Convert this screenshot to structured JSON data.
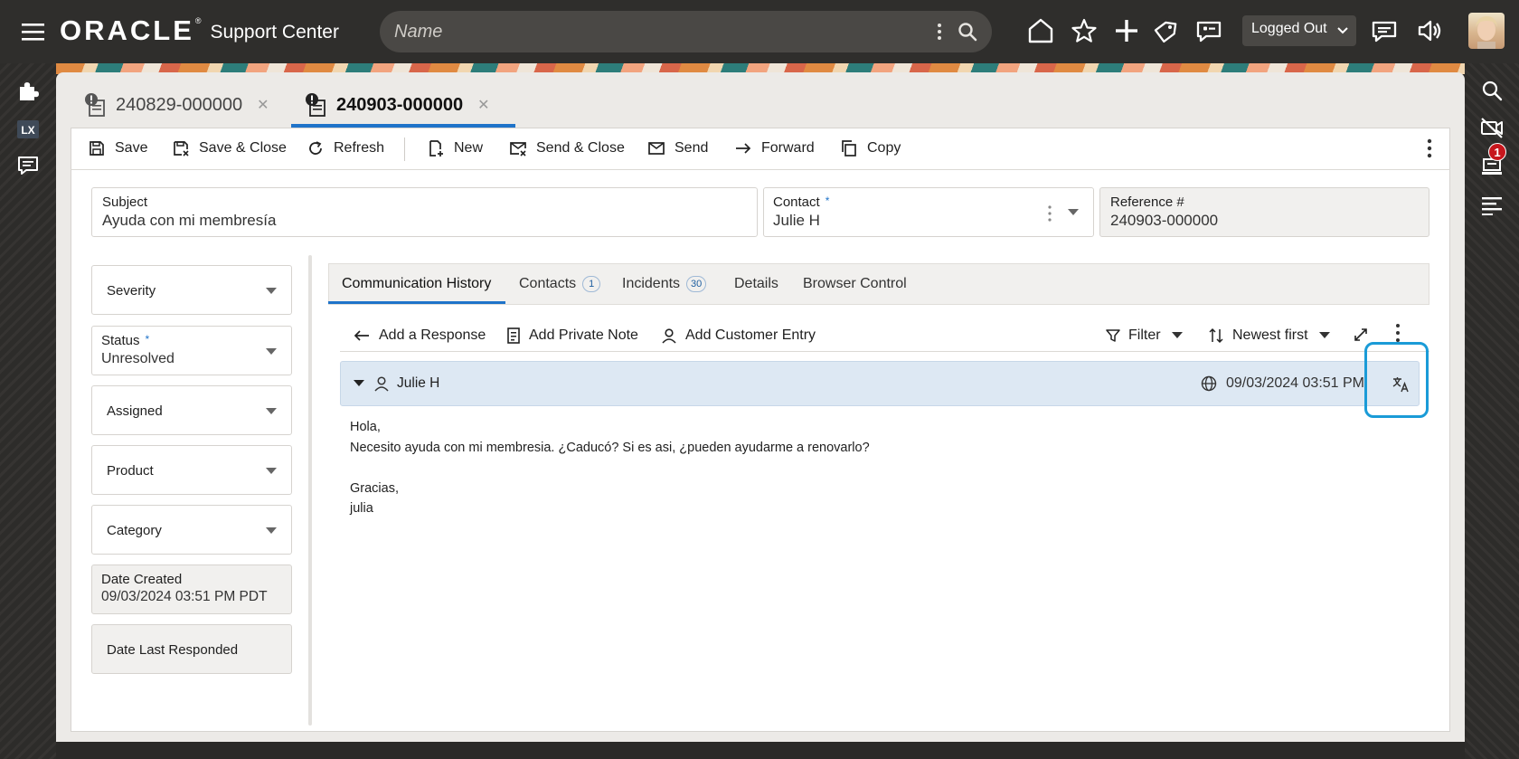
{
  "header": {
    "brand": "ORACLE",
    "reg_mark": "®",
    "product": "Support Center",
    "search_placeholder": "Name",
    "status_select": "Logged Out"
  },
  "record_tabs": [
    {
      "label": "240829-000000",
      "active": false
    },
    {
      "label": "240903-000000",
      "active": true
    }
  ],
  "toolbar": {
    "save": "Save",
    "save_close": "Save & Close",
    "refresh": "Refresh",
    "new": "New",
    "send_close": "Send & Close",
    "send": "Send",
    "forward": "Forward",
    "copy": "Copy"
  },
  "fields": {
    "subject_label": "Subject",
    "subject_value": "Ayuda con mi membresía",
    "contact_label": "Contact",
    "contact_required": "*",
    "contact_value": "Julie H",
    "reference_label": "Reference #",
    "reference_value": "240903-000000"
  },
  "left_panel": {
    "severity": "Severity",
    "status_label": "Status",
    "status_required": "*",
    "status_value": "Unresolved",
    "assigned": "Assigned",
    "product": "Product",
    "category": "Category",
    "date_created_label": "Date Created",
    "date_created_value": "09/03/2024 03:51 PM PDT",
    "date_last_responded": "Date Last Responded"
  },
  "inner_tabs": {
    "communication_history": "Communication History",
    "contacts": "Contacts",
    "contacts_count": "1",
    "incidents": "Incidents",
    "incidents_count": "30",
    "details": "Details",
    "browser_control": "Browser Control"
  },
  "actions": {
    "add_response": "Add a Response",
    "add_private_note": "Add Private Note",
    "add_customer_entry": "Add Customer Entry",
    "filter": "Filter",
    "sort": "Newest first"
  },
  "message": {
    "author": "Julie H",
    "timestamp": "09/03/2024 03:51 PM",
    "lines": [
      "Hola,",
      "Necesito ayuda con mi membresia. ¿Caducó? Si es asi, ¿pueden ayudarme a renovarlo?",
      "",
      "Gracias,",
      "julia"
    ]
  },
  "notifications": {
    "count": "1"
  },
  "left_rail": {
    "lx_label": "LX"
  },
  "colors": {
    "accent": "#1f73c9",
    "highlight": "#1a9bd7",
    "topbar": "#2f2e2c",
    "badge": "#c7161d"
  }
}
